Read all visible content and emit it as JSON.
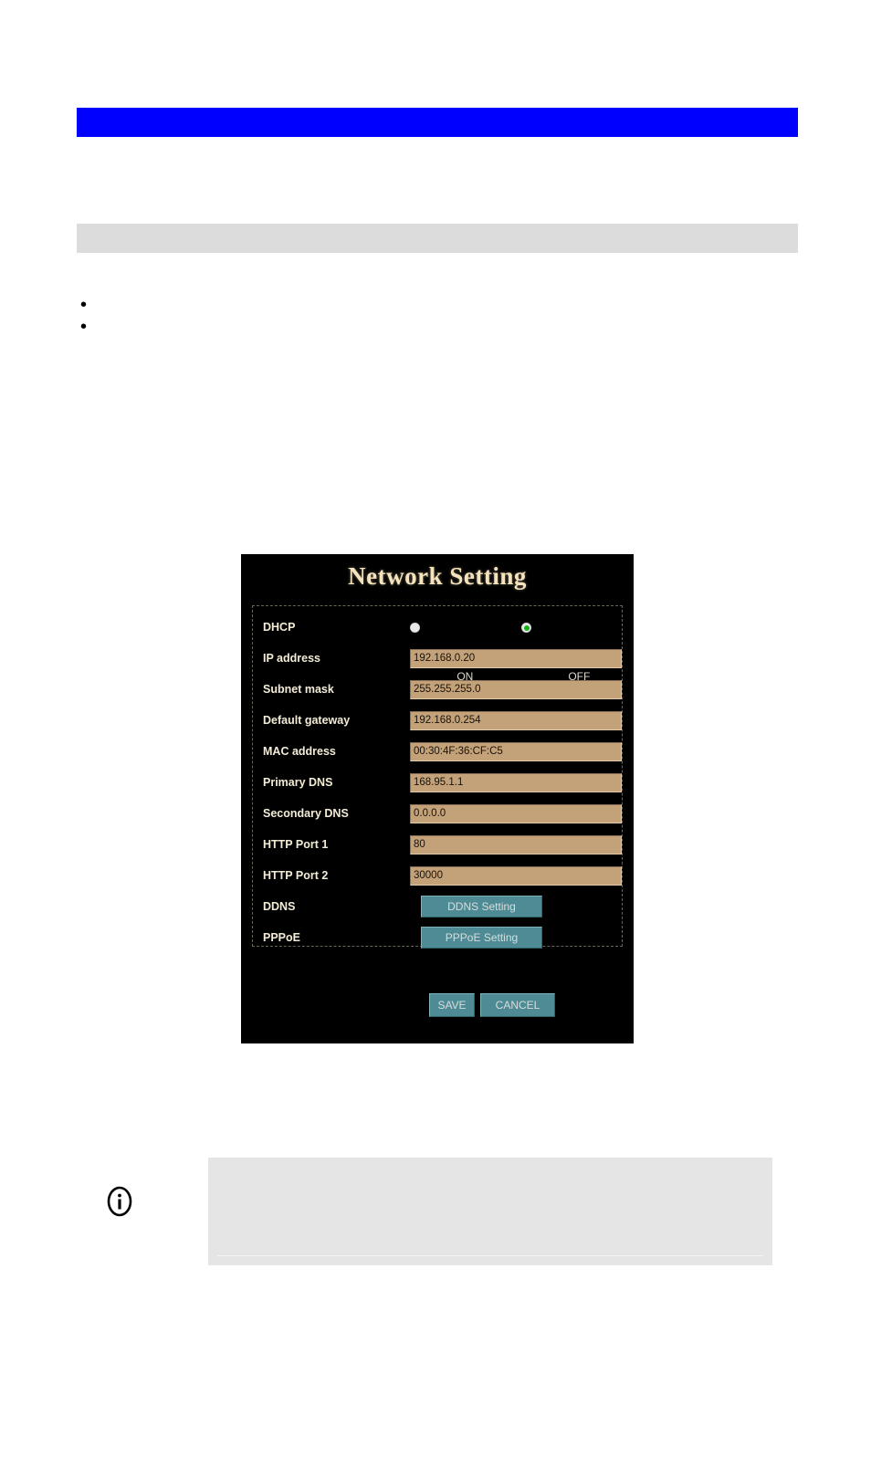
{
  "page": {
    "header_bar_text": "",
    "section_bar_text": "",
    "bullets": [
      "",
      ""
    ]
  },
  "device_ui": {
    "title": "Network Setting",
    "rows": [
      {
        "label": "DHCP",
        "type": "radio",
        "options": [
          "ON",
          "OFF"
        ],
        "selected": "OFF"
      },
      {
        "label": "IP address",
        "type": "input",
        "value": "192.168.0.20"
      },
      {
        "label": "Subnet mask",
        "type": "input",
        "value": "255.255.255.0"
      },
      {
        "label": "Default gateway",
        "type": "input",
        "value": "192.168.0.254"
      },
      {
        "label": "MAC address",
        "type": "input",
        "value": "00:30:4F:36:CF:C5"
      },
      {
        "label": "Primary DNS",
        "type": "input",
        "value": "168.95.1.1"
      },
      {
        "label": "Secondary DNS",
        "type": "input",
        "value": "0.0.0.0"
      },
      {
        "label": "HTTP Port 1",
        "type": "input",
        "value": "80"
      },
      {
        "label": "HTTP Port 2",
        "type": "input",
        "value": "30000"
      },
      {
        "label": "DDNS",
        "type": "button",
        "button_label": "DDNS Setting"
      },
      {
        "label": "PPPoE",
        "type": "button",
        "button_label": "PPPoE Setting"
      }
    ],
    "actions": {
      "save_label": "SAVE",
      "cancel_label": "CANCEL"
    },
    "colors": {
      "panel_background": "#000000",
      "title": "#f5e3bd",
      "label": "#f3ecd6",
      "field_background": "#c3a179",
      "button": "#4e8b95",
      "radio_selected": "#18b018"
    }
  },
  "note": {
    "icon": "info-icon",
    "text": ""
  }
}
